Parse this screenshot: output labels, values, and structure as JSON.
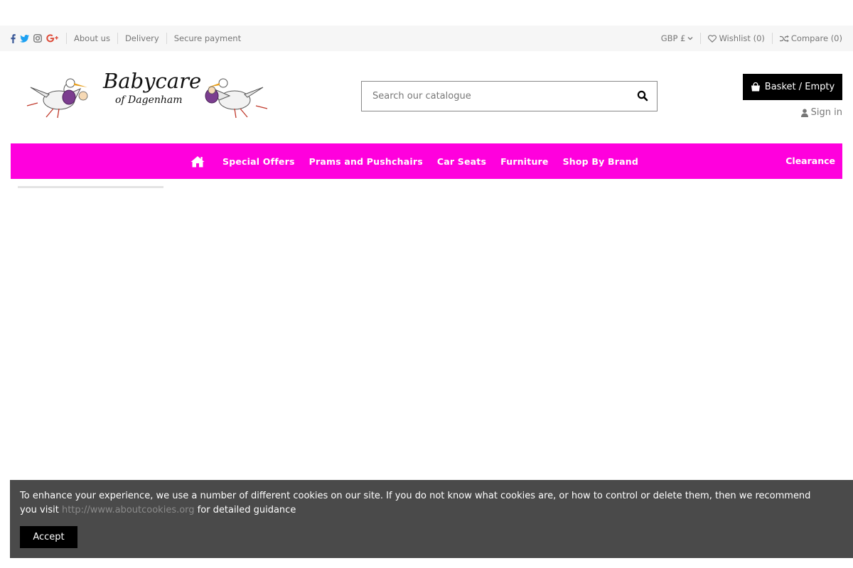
{
  "topbar": {
    "social": [
      {
        "name": "facebook-icon",
        "color": "#3b5998"
      },
      {
        "name": "twitter-icon",
        "color": "#1da1f2"
      },
      {
        "name": "instagram-icon",
        "color": "#777777"
      },
      {
        "name": "google-plus-icon",
        "color": "#dd4b39"
      }
    ],
    "links": [
      "About us",
      "Delivery",
      "Secure payment"
    ],
    "currency": "GBP £",
    "wishlist": "Wishlist (0)",
    "compare": "Compare (0)"
  },
  "header": {
    "logo_line1": "Babycare",
    "logo_line2": "of Dagenham",
    "search_placeholder": "Search our catalogue",
    "basket_label": "Basket / Empty",
    "signin_label": "Sign in"
  },
  "nav": {
    "bg_color": "#ff00dd",
    "items": [
      "Special Offers",
      "Prams and Pushchairs",
      "Car Seats",
      "Furniture",
      "Shop By Brand"
    ],
    "clearance": "Clearance"
  },
  "cookie": {
    "message_before": "To enhance your experience, we use a number of different cookies on our site. If you do not know what cookies are, or how to control or delete them, then we recommend you visit ",
    "link": "http://www.aboutcookies.org",
    "message_after": " for detailed guidance",
    "accept_label": "Accept"
  }
}
